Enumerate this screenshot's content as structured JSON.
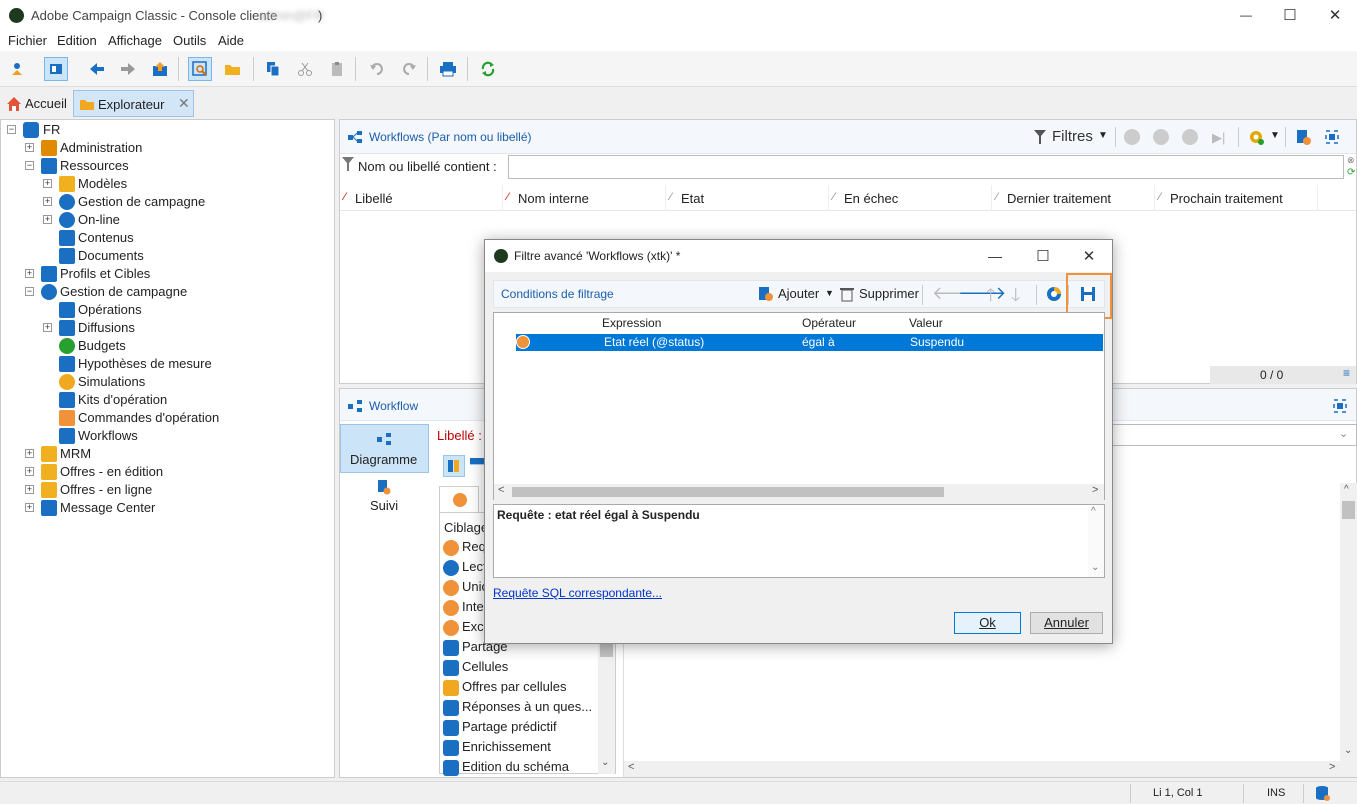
{
  "window": {
    "title": "Adobe Campaign Classic - Console cliente",
    "title_blurred": "admin@FR",
    "minimize": "—",
    "maximize": "☐",
    "close": "✕"
  },
  "menu": {
    "items": [
      "Fichier",
      "Edition",
      "Affichage",
      "Outils",
      "Aide"
    ]
  },
  "tabs": [
    {
      "label": "Accueil"
    },
    {
      "label": "Explorateur"
    }
  ],
  "tree": {
    "root": "FR",
    "items": [
      {
        "label": "Administration"
      },
      {
        "label": "Ressources"
      },
      {
        "label": "Modèles"
      },
      {
        "label": "Gestion de campagne"
      },
      {
        "label": "On-line"
      },
      {
        "label": "Contenus"
      },
      {
        "label": "Documents"
      },
      {
        "label": "Profils et Cibles"
      },
      {
        "label": "Gestion de campagne"
      },
      {
        "label": "Opérations"
      },
      {
        "label": "Diffusions"
      },
      {
        "label": "Budgets"
      },
      {
        "label": "Hypothèses de mesure"
      },
      {
        "label": "Simulations"
      },
      {
        "label": "Kits d'opération"
      },
      {
        "label": "Commandes d'opération"
      },
      {
        "label": "Workflows"
      },
      {
        "label": "MRM"
      },
      {
        "label": "Offres - en édition"
      },
      {
        "label": "Offres - en ligne"
      },
      {
        "label": "Message Center"
      }
    ]
  },
  "list_panel": {
    "title": "Workflows (Par nom ou libellé)",
    "filters_label": "Filtres",
    "search_label": "Nom ou libellé contient :",
    "search_value": "",
    "columns": [
      "Libellé",
      "Nom interne",
      "Etat",
      "En échec",
      "Dernier traitement",
      "Prochain traitement"
    ],
    "count": "0 / 0"
  },
  "detail_panel": {
    "title": "Workflow",
    "nav": [
      {
        "label": "Diagramme"
      },
      {
        "label": "Suivi"
      }
    ],
    "label_field": "Libellé :",
    "palette_header": "Ciblage",
    "palette": [
      {
        "label": "Requ"
      },
      {
        "label": "Lect"
      },
      {
        "label": "Unio"
      },
      {
        "label": "Inter"
      },
      {
        "label": "Excl"
      },
      {
        "label": "Partage"
      },
      {
        "label": "Cellules"
      },
      {
        "label": "Offres par cellules"
      },
      {
        "label": "Réponses à un ques..."
      },
      {
        "label": "Partage prédictif"
      },
      {
        "label": "Enrichissement"
      },
      {
        "label": "Edition du schéma"
      }
    ]
  },
  "dialog": {
    "title": "Filtre avancé 'Workflows (xtk)' *",
    "section_label": "Conditions de filtrage",
    "add_label": "Ajouter",
    "delete_label": "Supprimer",
    "grid_headers": [
      "Expression",
      "Opérateur",
      "Valeur"
    ],
    "row": {
      "expression": "Etat réel (@status)",
      "operator": "égal à",
      "value": "Suspendu"
    },
    "query_text": "Requête : etat réel égal à Suspendu",
    "sql_link": "Requête SQL correspondante...",
    "ok_label": "Ok",
    "cancel_label": "Annuler"
  },
  "statusbar": {
    "position": "Li 1, Col 1",
    "mode": "INS"
  },
  "colors": {
    "accent_blue": "#0078d7",
    "selection": "#0078d7",
    "highlight_orange": "#f0923a",
    "required_red": "#c00000",
    "link_blue": "#0033cc"
  }
}
